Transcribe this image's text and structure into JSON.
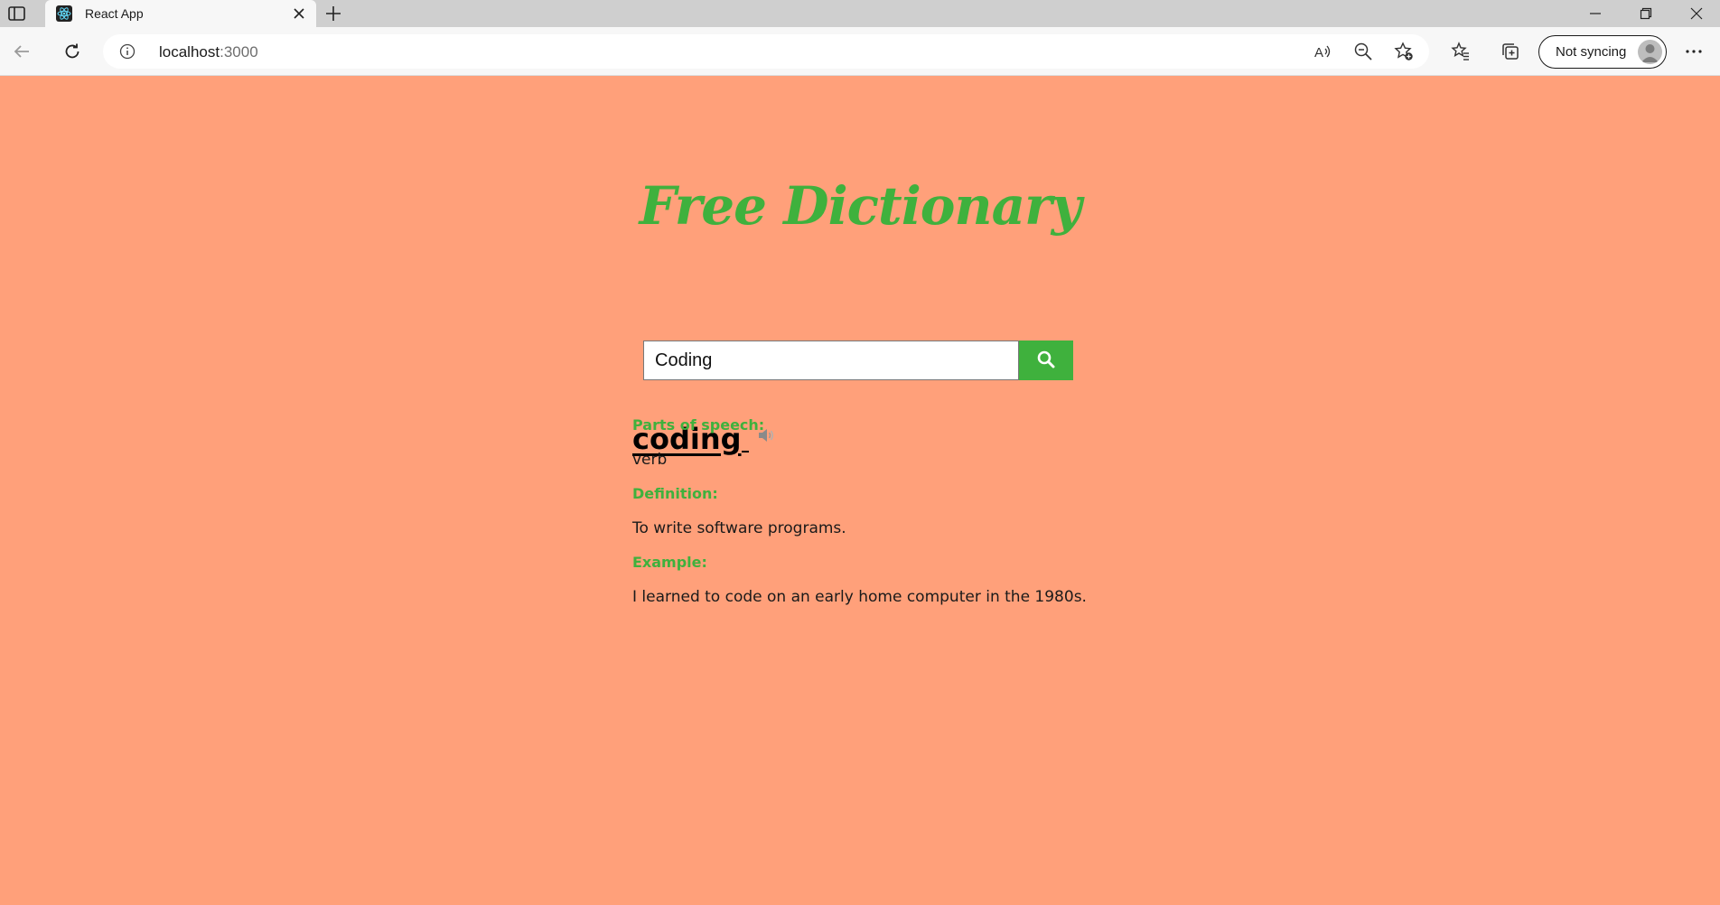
{
  "browser": {
    "tab_title": "React App",
    "address_host": "localhost",
    "address_port": ":3000",
    "sync_label": "Not syncing"
  },
  "app": {
    "title": "Free Dictionary",
    "search": {
      "value": "Coding"
    },
    "result": {
      "word": "coding",
      "parts_label": "Parts of speech:",
      "parts_value": "verb",
      "definition_label": "Definition:",
      "definition_value": "To write software programs.",
      "example_label": "Example:",
      "example_value": "I learned to code on an early home computer in the 1980s."
    }
  },
  "colors": {
    "page_background": "#ffa07a",
    "accent_green": "#3fb13d"
  }
}
